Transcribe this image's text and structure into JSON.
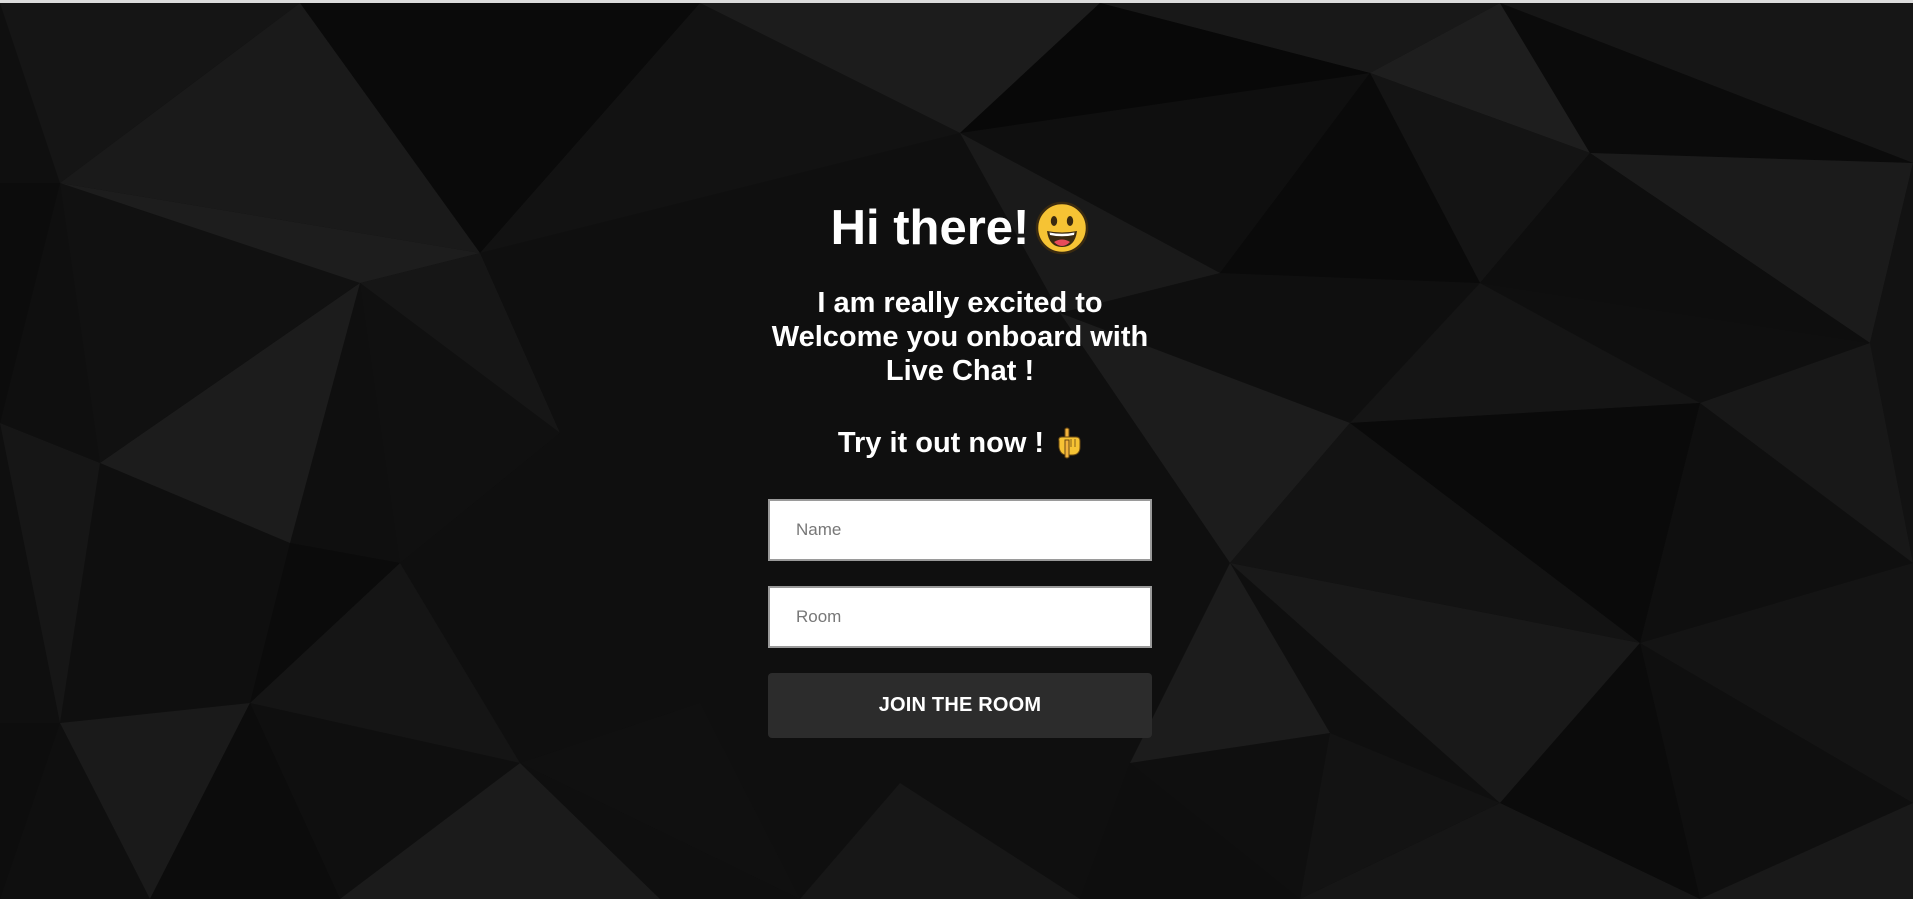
{
  "hero": {
    "title": "Hi there!",
    "title_emoji": "grinning-face-icon",
    "subtitle": "I am really excited to Welcome you onboard with Live Chat !",
    "cta_text": "Try it out now !",
    "cta_emoji": "pointing-down-hand-icon"
  },
  "form": {
    "name_placeholder": "Name",
    "name_value": "",
    "room_placeholder": "Room",
    "room_value": "",
    "submit_label": "JOIN THE ROOM"
  },
  "colors": {
    "background": "#111111",
    "button": "#2c2c2c",
    "text": "#ffffff",
    "emoji_yellow": "#f6c334"
  }
}
